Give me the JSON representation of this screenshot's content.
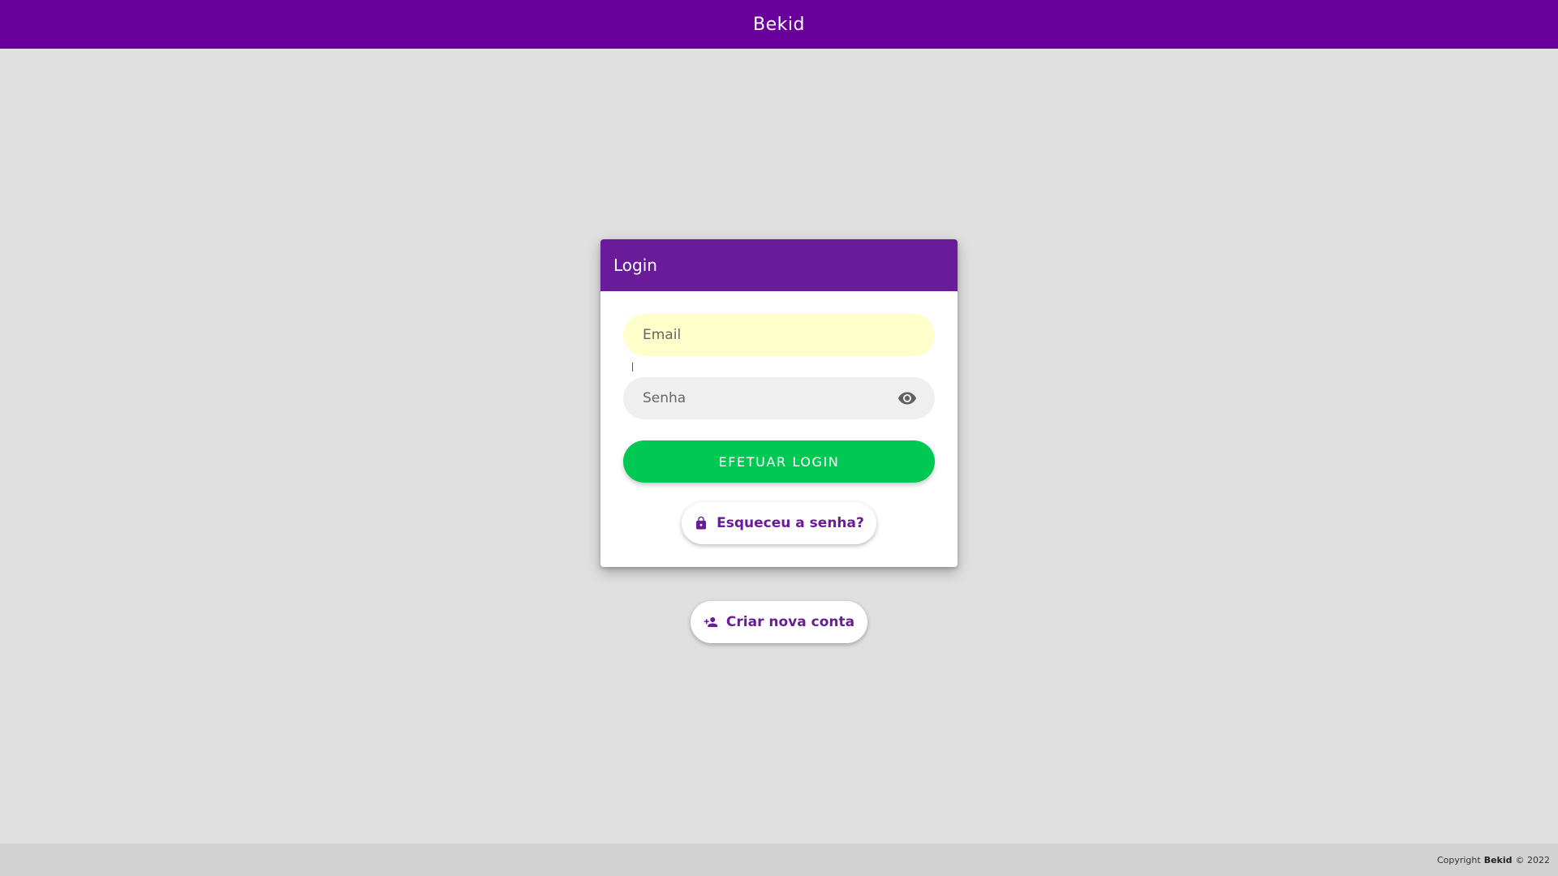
{
  "app": {
    "title": "Bekid"
  },
  "login_card": {
    "header": "Login",
    "email_placeholder": "Email",
    "password_placeholder": "Senha",
    "login_button": "EFETUAR LOGIN",
    "forgot_password": "Esqueceu a senha?"
  },
  "create_account": {
    "label": "Criar nova conta"
  },
  "footer": {
    "prefix": "Copyright",
    "brand": "Bekid",
    "suffix": "© 2022"
  },
  "icons": {
    "password_toggle": "eye-icon",
    "forgot": "lock-icon",
    "create": "person-add-icon"
  },
  "colors": {
    "brand_purple": "#6a009c",
    "card_header": "#6a1b9a",
    "login_green": "#00c853",
    "email_autofill": "#ffffcc"
  }
}
